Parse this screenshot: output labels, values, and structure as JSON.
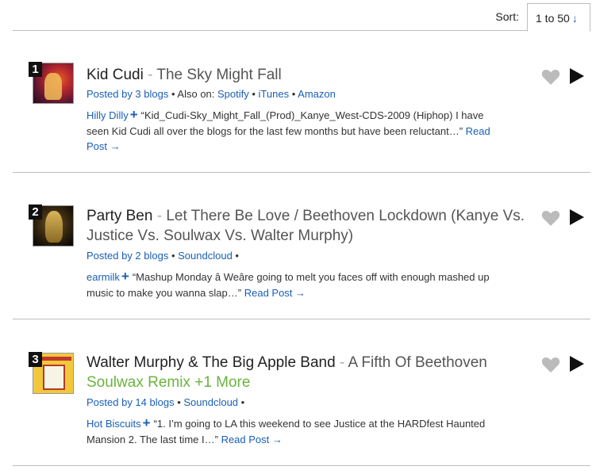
{
  "sort": {
    "label": "Sort:",
    "value": "1 to 50",
    "arrow": "↓"
  },
  "separator": " - ",
  "tracks": [
    {
      "rank": "1",
      "artist": "Kid Cudi",
      "song": "The Sky Might Fall",
      "posted": "Posted by 3 blogs",
      "also_on_label": " • Also on: ",
      "services": [
        "Spotify",
        "iTunes",
        "Amazon"
      ],
      "service_sep": " • ",
      "blog": "Hilly Dilly",
      "excerpt": "“Kid_Cudi-Sky_Might_Fall_(Prod)_Kanye_West-CDS-2009 (Hiphop) I have seen Kid Cudi all over the blogs for the last few months but have been reluctant…”",
      "read_more": "Read Post →",
      "thumb_icon": "album-art-kid-cudi"
    },
    {
      "rank": "2",
      "artist": "Party Ben",
      "song": "Let There Be Love / Beethoven Lockdown (Kanye Vs. Justice Vs. Soulwax Vs. Walter Murphy)",
      "posted": "Posted by 2 blogs",
      "services": [
        "Soundcloud"
      ],
      "service_sep": " • ",
      "trailing_bullet": " •",
      "blog": "earmilk",
      "excerpt": "“Mashup Monday â Weâre going to melt you faces off with enough mashed up music to make you wanna slap…”",
      "read_more": "Read Post →",
      "thumb_icon": "album-art-party-ben"
    },
    {
      "rank": "3",
      "artist": "Walter Murphy & The Big Apple Band",
      "song": "A Fifth Of Beethoven",
      "remix": "Soulwax Remix",
      "more": "+1 More",
      "posted": "Posted by 14 blogs",
      "services": [
        "Soundcloud"
      ],
      "service_sep": " • ",
      "trailing_bullet": " •",
      "blog": "Hot Biscuits",
      "excerpt": "“1. I’m going to LA this weekend to see Justice at the HARDfest Haunted Mansion 2. The last time I…”",
      "read_more": "Read Post →",
      "thumb_icon": "album-art-walter-murphy"
    }
  ],
  "icons": {
    "heart": "heart-icon",
    "play": "play-icon"
  },
  "colors": {
    "link": "#1a5fb4",
    "remix": "#6cb33f",
    "heart": "#bbbbbb"
  }
}
